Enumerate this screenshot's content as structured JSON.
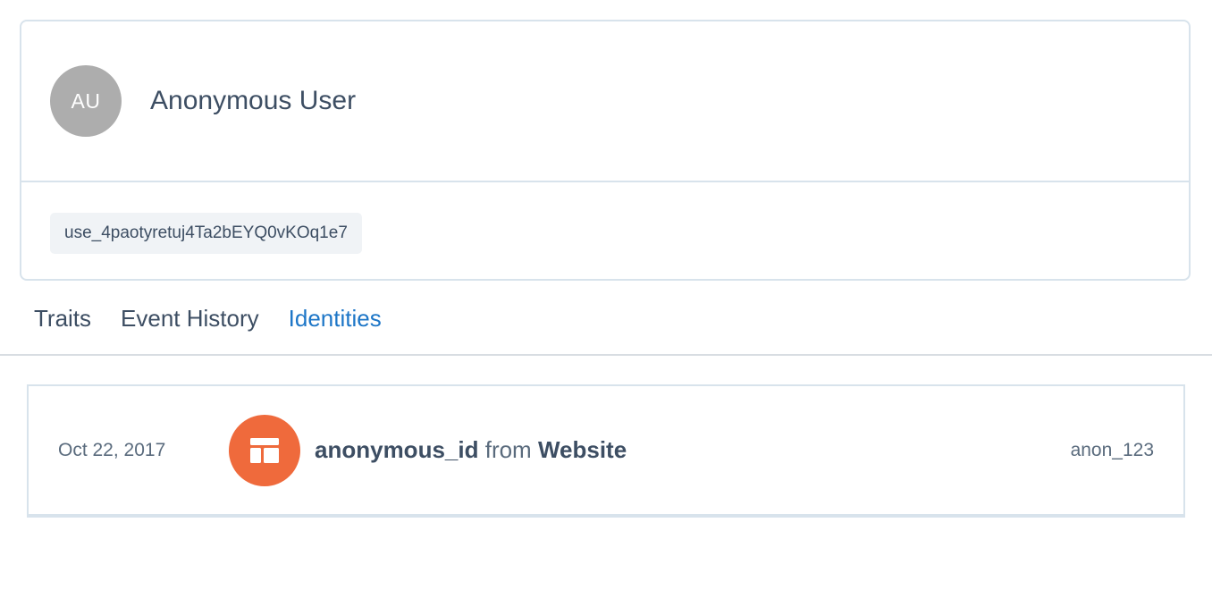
{
  "profile": {
    "avatar_initials": "AU",
    "name": "Anonymous User",
    "user_id": "use_4paotyretuj4Ta2bEYQ0vKOq1e7"
  },
  "tabs": [
    {
      "label": "Traits",
      "active": false
    },
    {
      "label": "Event History",
      "active": false
    },
    {
      "label": "Identities",
      "active": true
    }
  ],
  "identities": [
    {
      "date": "Oct 22, 2017",
      "icon": "website-layout-icon",
      "key": "anonymous_id",
      "connector": "from",
      "source": "Website",
      "value": "anon_123"
    }
  ],
  "colors": {
    "accent": "#1d76c7",
    "avatar": "#adadad",
    "source_icon": "#ef6a3c",
    "border": "#d8e3ec"
  }
}
